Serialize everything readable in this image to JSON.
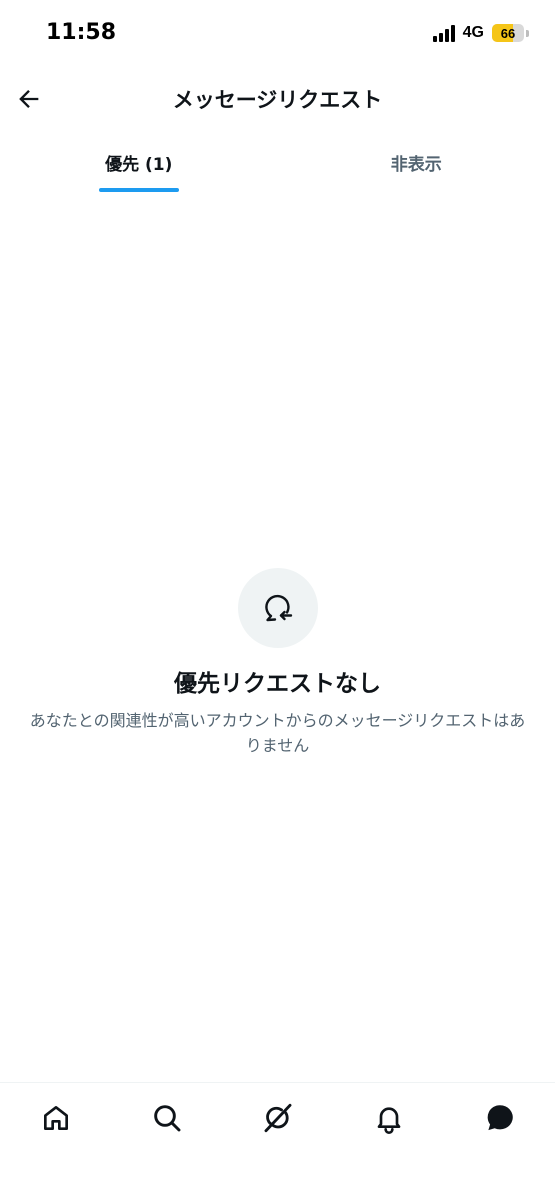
{
  "status_bar": {
    "time": "11:58",
    "network": "4G",
    "battery_level": "66",
    "battery_fraction": 0.66
  },
  "header": {
    "title": "メッセージリクエスト",
    "back_icon": "arrow-left-icon"
  },
  "tabs": [
    {
      "label": "優先 (1)",
      "active": true
    },
    {
      "label": "非表示",
      "active": false
    }
  ],
  "empty_state": {
    "icon": "message-request-icon",
    "title": "優先リクエストなし",
    "description": "あなたとの関連性が高いアカウントからのメッセージリクエストはありません"
  },
  "bottom_nav": {
    "items": [
      "home-icon",
      "search-icon",
      "grok-icon",
      "notifications-icon",
      "messages-icon"
    ]
  },
  "colors": {
    "accent": "#1d9bf0",
    "text_primary": "#0f1419",
    "text_secondary": "#536471",
    "icon_bg": "#eff3f4",
    "battery": "#f5c518"
  }
}
